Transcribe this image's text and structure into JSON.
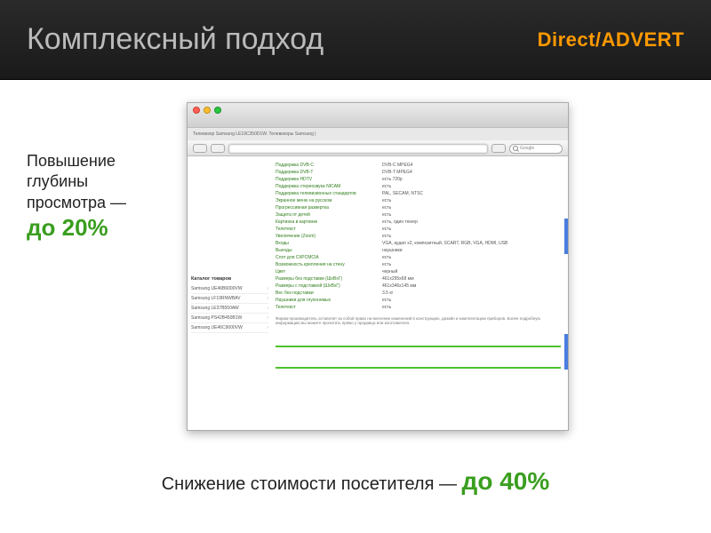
{
  "header": {
    "title": "Комплексный подход",
    "logo_prefix": "Direct",
    "logo_slash": "/",
    "logo_suffix": "ADVERT"
  },
  "left_callout": {
    "line1": "Повышение",
    "line2": "глубины",
    "line3": "просмотра —",
    "highlight": "до 20%"
  },
  "bottom_callout": {
    "prefix": "Снижение стоимости посетителя — ",
    "highlight": "до 40%"
  },
  "browser": {
    "tab_title": "Телевизор Samsung LE19C350D1W. Телевизоры Samsung |",
    "search_placeholder": "Google",
    "sidebar": {
      "title": "Каталог товаров",
      "items": [
        "Samsung UE46B6000VW",
        "Samsung LF19RNWBAV",
        "Samsung LE37B550AW",
        "Samsung PS42B450B1W",
        "Samsung UE46C9000VW"
      ]
    },
    "specs": [
      {
        "label": "Поддержка DVB-C",
        "value": "DVB-C MPEG4"
      },
      {
        "label": "Поддержка DVB-T",
        "value": "DVB-T MPEG4"
      },
      {
        "label": "Поддержка HDTV",
        "value": "есть 720p"
      },
      {
        "label": "Поддержка стереозвука NICAM",
        "value": "есть"
      },
      {
        "label": "Поддержка телевизионных стандартов",
        "value": "PAL, SECAM, NTSC"
      },
      {
        "label": "Экранное меню на русском",
        "value": "есть"
      },
      {
        "label": "Прогрессивная развертка",
        "value": "есть"
      },
      {
        "label": "Защита от детей",
        "value": "есть"
      },
      {
        "label": "Картинка в картинке",
        "value": "есть, один тюнер"
      },
      {
        "label": "Телетекст",
        "value": "есть"
      },
      {
        "label": "Увеличение (Zoom)",
        "value": "есть"
      },
      {
        "label": "Входы",
        "value": "VGA, аудио x2, композитный, SCART, RGB, VGA, HDMI, USB"
      },
      {
        "label": "Выходы",
        "value": "наушники"
      },
      {
        "label": "Слот для CI/PCMCIA",
        "value": "есть"
      },
      {
        "label": "Возможность крепления на стену",
        "value": "есть"
      },
      {
        "label": "Цвет",
        "value": "черный"
      },
      {
        "label": "Размеры без подставки (ШxВxГ)",
        "value": "461x295x68 мм"
      },
      {
        "label": "Размеры с подставкой (ШxВxГ)",
        "value": "461x346x145 мм"
      },
      {
        "label": "Вес без подставки",
        "value": "3.5 кг"
      },
      {
        "label": "Наушники для глухонемых",
        "value": "есть"
      },
      {
        "label": "Телетекст",
        "value": "есть"
      }
    ],
    "disclaimer": "Фирма-производитель оставляет за собой право на внесение изменений в конструкцию, дизайн и комплектацию приборов. Более подробную информацию вы можете прочитать прямо у продавца или изготовителя."
  }
}
